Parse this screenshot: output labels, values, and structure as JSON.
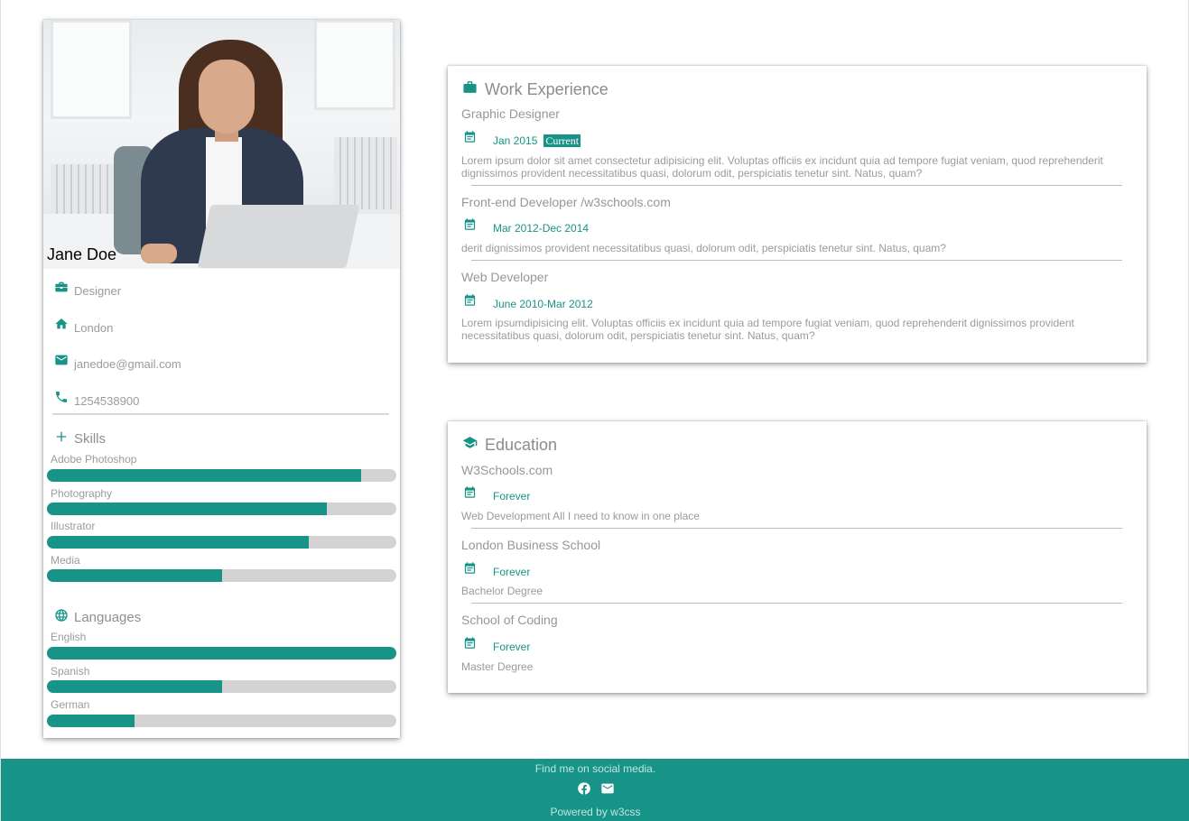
{
  "profile": {
    "name": "Jane Doe",
    "info": [
      {
        "icon": "briefcase-icon",
        "text": "Designer"
      },
      {
        "icon": "home-icon",
        "text": "London"
      },
      {
        "icon": "email-icon",
        "text": "janedoe@gmail.com"
      },
      {
        "icon": "phone-icon",
        "text": "1254538900"
      }
    ],
    "skills_heading": "Skills",
    "skills": [
      {
        "label": "Adobe Photoshop",
        "percent": 90
      },
      {
        "label": "Photography",
        "percent": 80
      },
      {
        "label": "Illustrator",
        "percent": 75
      },
      {
        "label": "Media",
        "percent": 50
      }
    ],
    "languages_heading": "Languages",
    "languages": [
      {
        "label": "English",
        "percent": 100
      },
      {
        "label": "Spanish",
        "percent": 50
      },
      {
        "label": "German",
        "percent": 25
      }
    ]
  },
  "work": {
    "heading": "Work Experience",
    "entries": [
      {
        "title": "Graphic Designer",
        "date": "Jan 2015",
        "tag": "Current",
        "desc": "Lorem ipsum dolor sit amet consectetur adipisicing elit. Voluptas officiis ex incidunt quia ad tempore fugiat veniam, quod reprehenderit dignissimos provident necessitatibus quasi, dolorum odit, perspiciatis tenetur sint. Natus, quam?"
      },
      {
        "title": "Front-end Developer /w3schools.com",
        "date": "Mar 2012-Dec 2014",
        "desc": "derit dignissimos provident necessitatibus quasi, dolorum odit, perspiciatis tenetur sint. Natus, quam?"
      },
      {
        "title": "Web Developer",
        "date": "June 2010-Mar 2012",
        "desc": "Lorem ipsumdipisicing elit. Voluptas officiis ex incidunt quia ad tempore fugiat veniam, quod reprehenderit dignissimos provident necessitatibus quasi, dolorum odit, perspiciatis tenetur sint. Natus, quam?"
      }
    ]
  },
  "education": {
    "heading": "Education",
    "entries": [
      {
        "title": "W3Schools.com",
        "date": "Forever",
        "desc": "Web Development All I need to know in one place"
      },
      {
        "title": "London Business School",
        "date": "Forever",
        "desc": "Bachelor Degree"
      },
      {
        "title": "School of Coding",
        "date": "Forever",
        "desc": "Master Degree"
      }
    ]
  },
  "footer": {
    "find": "Find me on social media.",
    "icons": [
      "facebook-icon",
      "email-icon"
    ],
    "powered": "Powered by w3css"
  },
  "colors": {
    "accent": "#179487",
    "bar_track": "#d3d3d3"
  }
}
